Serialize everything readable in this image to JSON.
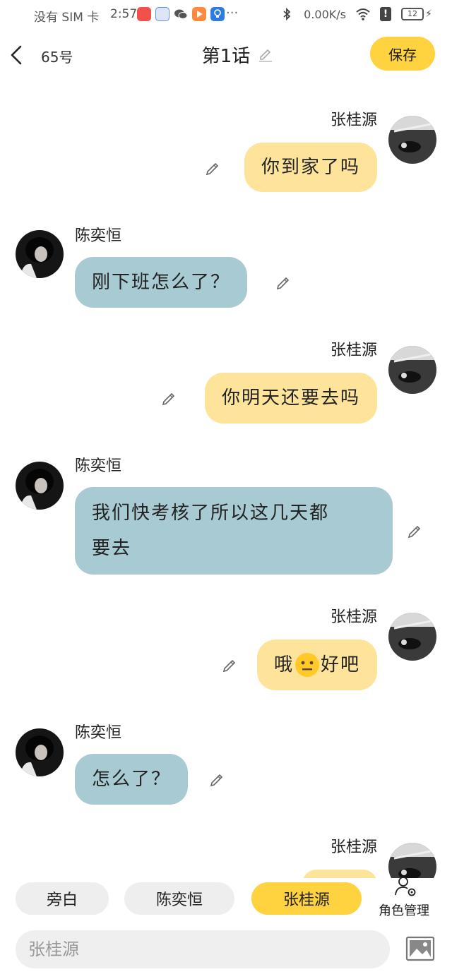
{
  "status_bar": {
    "carrier": "没有 SIM 卡",
    "time": "2:57",
    "more": "···",
    "net_speed": "0.00K/s",
    "battery": "12"
  },
  "header": {
    "episode_code": "65号",
    "title": "第1话",
    "save_label": "保存"
  },
  "messages": [
    {
      "speaker": "张桂源",
      "text": "你到家了吗",
      "side": "right"
    },
    {
      "speaker": "陈奕恒",
      "text": "刚下班怎么了？",
      "side": "left"
    },
    {
      "speaker": "张桂源",
      "text": "你明天还要去吗",
      "side": "right"
    },
    {
      "speaker": "陈奕恒",
      "text_line1": "我们快考核了所以这几天都",
      "text_line2": "要去",
      "side": "left"
    },
    {
      "speaker": "张桂源",
      "text_before": "哦",
      "emoji": "neutral-face",
      "text_after": "好吧",
      "side": "right"
    },
    {
      "speaker": "陈奕恒",
      "text": "怎么了？",
      "side": "left"
    },
    {
      "speaker": "张桂源",
      "side": "right"
    }
  ],
  "roles": {
    "chips": [
      "旁白",
      "陈奕恒",
      "张桂源"
    ],
    "active": "张桂源",
    "manage_label": "角色管理"
  },
  "input": {
    "placeholder": "张桂源"
  },
  "colors": {
    "accent": "#ffd23f",
    "bubble_right": "#fde49a",
    "bubble_left": "#a8cbd3"
  }
}
